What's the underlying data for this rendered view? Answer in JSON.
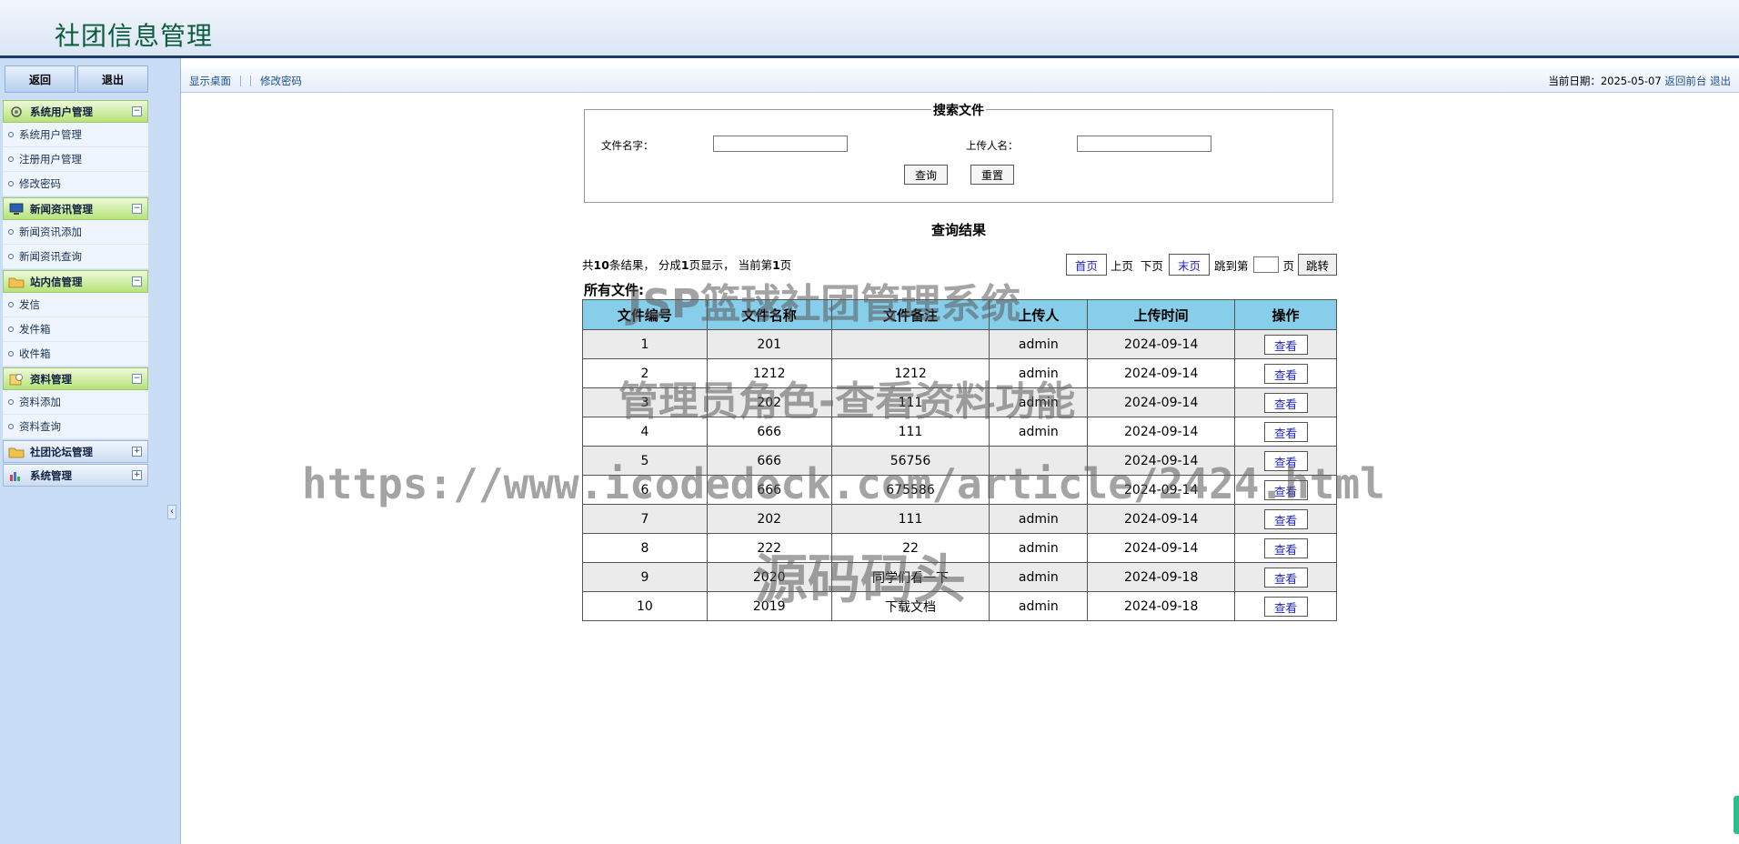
{
  "header": {
    "title": "社团信息管理"
  },
  "sidebar": {
    "buttons": {
      "back": "返回",
      "logout": "退出"
    },
    "groups": [
      {
        "label": "系统用户管理",
        "icon": "gear-icon",
        "expanded": true,
        "items": [
          "系统用户管理",
          "注册用户管理",
          "修改密码"
        ]
      },
      {
        "label": "新闻资讯管理",
        "icon": "monitor-icon",
        "expanded": true,
        "items": [
          "新闻资讯添加",
          "新闻资讯查询"
        ]
      },
      {
        "label": "站内信管理",
        "icon": "folder-icon",
        "expanded": true,
        "items": [
          "发信",
          "发件箱",
          "收件箱"
        ]
      },
      {
        "label": "资料管理",
        "icon": "clock-icon",
        "expanded": true,
        "items": [
          "资料添加",
          "资料查询"
        ]
      },
      {
        "label": "社团论坛管理",
        "icon": "folder-icon",
        "expanded": false,
        "items": []
      },
      {
        "label": "系统管理",
        "icon": "chart-icon",
        "expanded": false,
        "items": []
      }
    ],
    "collapse_glyph": "‹"
  },
  "toolbar": {
    "show_desktop": "显示桌面",
    "change_password": "修改密码",
    "date_label": "当前日期：",
    "date_value": "2025-05-07",
    "back_front": "返回前台",
    "logout": "退出"
  },
  "search": {
    "legend": "搜索文件",
    "file_name_label": "文件名字：",
    "file_name_value": "",
    "uploader_label": "上传人名：",
    "uploader_value": "",
    "query_button": "查询",
    "reset_button": "重置"
  },
  "results": {
    "title": "查询结果",
    "summary": {
      "p1": "共",
      "total": "10",
      "p2": "条结果，  分成",
      "pages": "1",
      "p3": "页显示，  当前第",
      "current": "1",
      "p4": "页"
    },
    "pager": {
      "first": "首页",
      "prev": "上页",
      "next": "下页",
      "last": "末页",
      "jump_prefix": "跳到第",
      "jump_suffix": "页",
      "jump_button": "跳转"
    },
    "section_label": "所有文件:",
    "columns": [
      "文件编号",
      "文件名称",
      "文件备注",
      "上传人",
      "上传时间",
      "操作"
    ],
    "view_label": "查看",
    "rows": [
      [
        "1",
        "201",
        "",
        "admin",
        "2024-09-14"
      ],
      [
        "2",
        "1212",
        "1212",
        "admin",
        "2024-09-14"
      ],
      [
        "3",
        "202",
        "111",
        "admin",
        "2024-09-14"
      ],
      [
        "4",
        "666",
        "111",
        "admin",
        "2024-09-14"
      ],
      [
        "5",
        "666",
        "56756",
        "",
        "2024-09-14"
      ],
      [
        "6",
        "666",
        "675586",
        "",
        "2024-09-14"
      ],
      [
        "7",
        "202",
        "111",
        "admin",
        "2024-09-14"
      ],
      [
        "8",
        "222",
        "22",
        "admin",
        "2024-09-14"
      ],
      [
        "9",
        "2020",
        "同学们看一下",
        "admin",
        "2024-09-18"
      ],
      [
        "10",
        "2019",
        "下载文档",
        "admin",
        "2024-09-18"
      ]
    ]
  },
  "watermarks": [
    "JSP篮球社团管理系统",
    "管理员角色-查看资料功能",
    "https://www.icodedock.com/article/2424.html",
    "源码码头"
  ]
}
